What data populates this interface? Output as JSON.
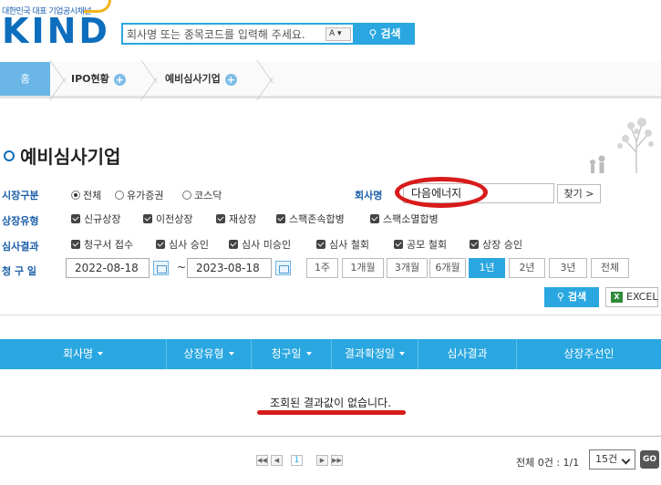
{
  "header": {
    "tagline": "대한민국 대표 기업공시채널",
    "logo": "KIND",
    "search_placeholder": "회사명 또는 종목코드를 입력해 주세요.",
    "search_font_toggle": "A ▾",
    "search_button": "검색"
  },
  "breadcrumb": {
    "home": "홈",
    "items": [
      "IPO현황",
      "예비심사기업"
    ]
  },
  "page_title": "예비심사기업",
  "filters": {
    "market": {
      "label": "시장구분",
      "options": [
        "전체",
        "유가증권",
        "코스닥"
      ],
      "selected": "전체"
    },
    "company": {
      "label": "회사명",
      "value": "다음에너지",
      "find_button": "찾기 >"
    },
    "listing_type": {
      "label": "상장유형",
      "options": [
        "신규상장",
        "이전상장",
        "재상장",
        "스팩존속합병",
        "스팩소멸합병"
      ]
    },
    "review_result": {
      "label": "심사결과",
      "options": [
        "청구서 접수",
        "심사 승인",
        "심사 미승인",
        "심사 철회",
        "공모 철회",
        "상장 승인"
      ]
    },
    "request_date": {
      "label": "청 구 일",
      "from": "2022-08-18",
      "to": "2023-08-18",
      "separator": "~",
      "periods": [
        "1주",
        "1개월",
        "3개월",
        "6개월",
        "1년",
        "2년",
        "3년",
        "전체"
      ],
      "active_period": "1년"
    },
    "search_button": "검색",
    "excel_button": "EXCEL"
  },
  "table": {
    "columns": [
      "회사명",
      "상장유형",
      "청구일",
      "결과확정일",
      "심사결과",
      "상장주선인"
    ],
    "empty_message": "조회된 결과값이 없습니다."
  },
  "pagination": {
    "first": "◀◀",
    "prev": "◀",
    "current_page": "1",
    "next": "▶",
    "last": "▶▶",
    "summary": "전체 0건 : 1/1",
    "page_size": "15건",
    "go_button": "GO"
  },
  "colors": {
    "accent": "#2aa7e0",
    "brand": "#0d6ebd",
    "label": "#1a5fa8",
    "highlight": "#d81b1b"
  }
}
